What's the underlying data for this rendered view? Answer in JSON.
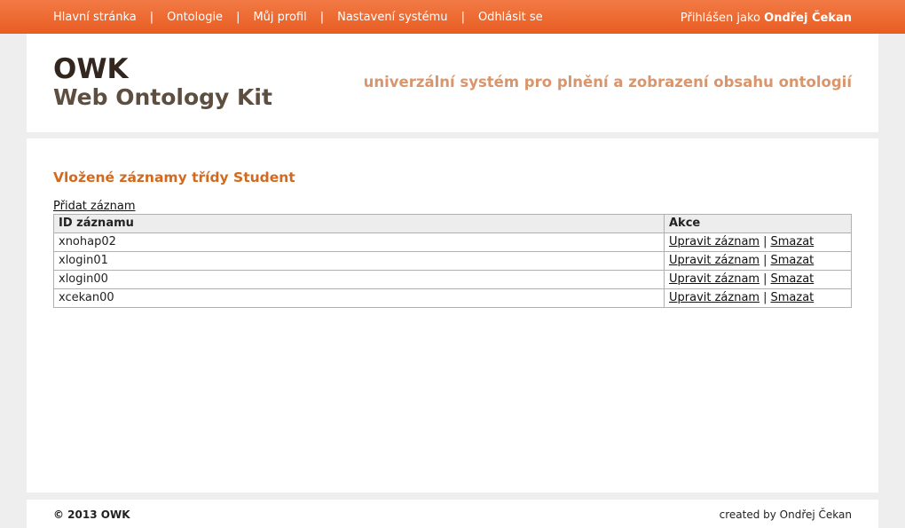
{
  "nav": {
    "items": [
      {
        "label": "Hlavní stránka"
      },
      {
        "label": "Ontologie"
      },
      {
        "label": "Můj profil"
      },
      {
        "label": "Nastavení systému"
      },
      {
        "label": "Odhlásit se"
      }
    ],
    "separator": "|"
  },
  "login": {
    "prefix": "Přihlášen jako",
    "user": "Ondřej Čekan"
  },
  "header": {
    "logo_main": "OWK",
    "logo_sub": "Web Ontology Kit",
    "tagline": "univerzální systém pro plnění a zobrazení obsahu ontologií"
  },
  "main": {
    "title": "Vložené záznamy třídy Student",
    "add_link": "Přidat záznam",
    "table": {
      "headers": [
        "ID záznamu",
        "Akce"
      ],
      "rows": [
        {
          "id": "xnohap02",
          "edit": "Upravit záznam",
          "delete": "Smazat"
        },
        {
          "id": "xlogin01",
          "edit": "Upravit záznam",
          "delete": "Smazat"
        },
        {
          "id": "xlogin00",
          "edit": "Upravit záznam",
          "delete": "Smazat"
        },
        {
          "id": "xcekan00",
          "edit": "Upravit záznam",
          "delete": "Smazat"
        }
      ],
      "action_separator": "|"
    }
  },
  "footer": {
    "copyright": "© 2013 OWK",
    "credit": "created by Ondřej Čekan"
  },
  "colors": {
    "accent": "#e85d22",
    "title": "#d2691e",
    "tagline": "#d9956b"
  }
}
